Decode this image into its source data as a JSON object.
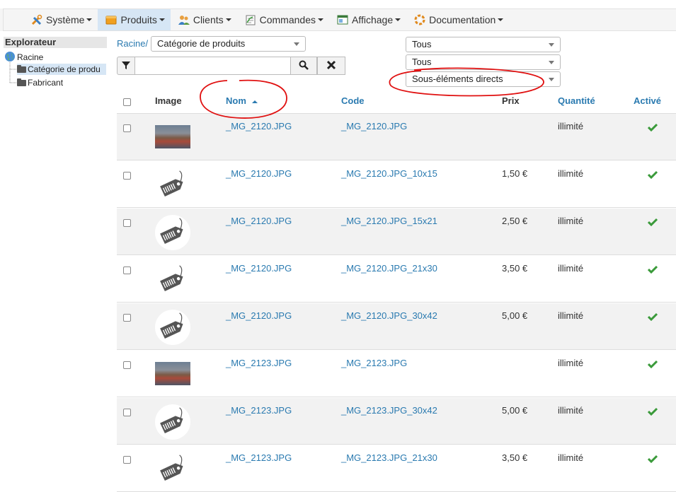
{
  "menu": {
    "items": [
      {
        "label": "Système",
        "icon": "tools-icon"
      },
      {
        "label": "Produits",
        "icon": "box-icon"
      },
      {
        "label": "Clients",
        "icon": "users-icon"
      },
      {
        "label": "Commandes",
        "icon": "clipboard-icon"
      },
      {
        "label": "Affichage",
        "icon": "window-icon"
      },
      {
        "label": "Documentation",
        "icon": "help-icon"
      }
    ]
  },
  "explorer": {
    "title": "Explorateur",
    "root": "Racine",
    "children": [
      "Catégorie de produ",
      "Fabricant"
    ]
  },
  "toolbar": {
    "breadcrumb": "Racine/",
    "category_select": "Catégorie de produits",
    "filter1": "Tous",
    "filter2": "Tous",
    "filter3": "Sous-éléments directs",
    "search_placeholder": ""
  },
  "table": {
    "headers": {
      "image": "Image",
      "nom": "Nom",
      "code": "Code",
      "prix": "Prix",
      "quantite": "Quantité",
      "active": "Activé"
    },
    "rows": [
      {
        "thumb": "photo",
        "nom": "_MG_2120.JPG",
        "code": "_MG_2120.JPG",
        "prix": "",
        "quantite": "illimité"
      },
      {
        "thumb": "tag",
        "nom": "_MG_2120.JPG",
        "code": "_MG_2120.JPG_10x15",
        "prix": "1,50 €",
        "quantite": "illimité"
      },
      {
        "thumb": "tag",
        "nom": "_MG_2120.JPG",
        "code": "_MG_2120.JPG_15x21",
        "prix": "2,50 €",
        "quantite": "illimité"
      },
      {
        "thumb": "tag",
        "nom": "_MG_2120.JPG",
        "code": "_MG_2120.JPG_21x30",
        "prix": "3,50 €",
        "quantite": "illimité"
      },
      {
        "thumb": "tag",
        "nom": "_MG_2120.JPG",
        "code": "_MG_2120.JPG_30x42",
        "prix": "5,00 €",
        "quantite": "illimité"
      },
      {
        "thumb": "photo",
        "nom": "_MG_2123.JPG",
        "code": "_MG_2123.JPG",
        "prix": "",
        "quantite": "illimité"
      },
      {
        "thumb": "tag",
        "nom": "_MG_2123.JPG",
        "code": "_MG_2123.JPG_30x42",
        "prix": "5,00 €",
        "quantite": "illimité"
      },
      {
        "thumb": "tag",
        "nom": "_MG_2123.JPG",
        "code": "_MG_2123.JPG_21x30",
        "prix": "3,50 €",
        "quantite": "illimité"
      }
    ]
  },
  "colors": {
    "link": "#2a7ab0",
    "active_menu": "#d6e6f5",
    "check": "#3a9a3a",
    "annotation": "#e01010"
  }
}
